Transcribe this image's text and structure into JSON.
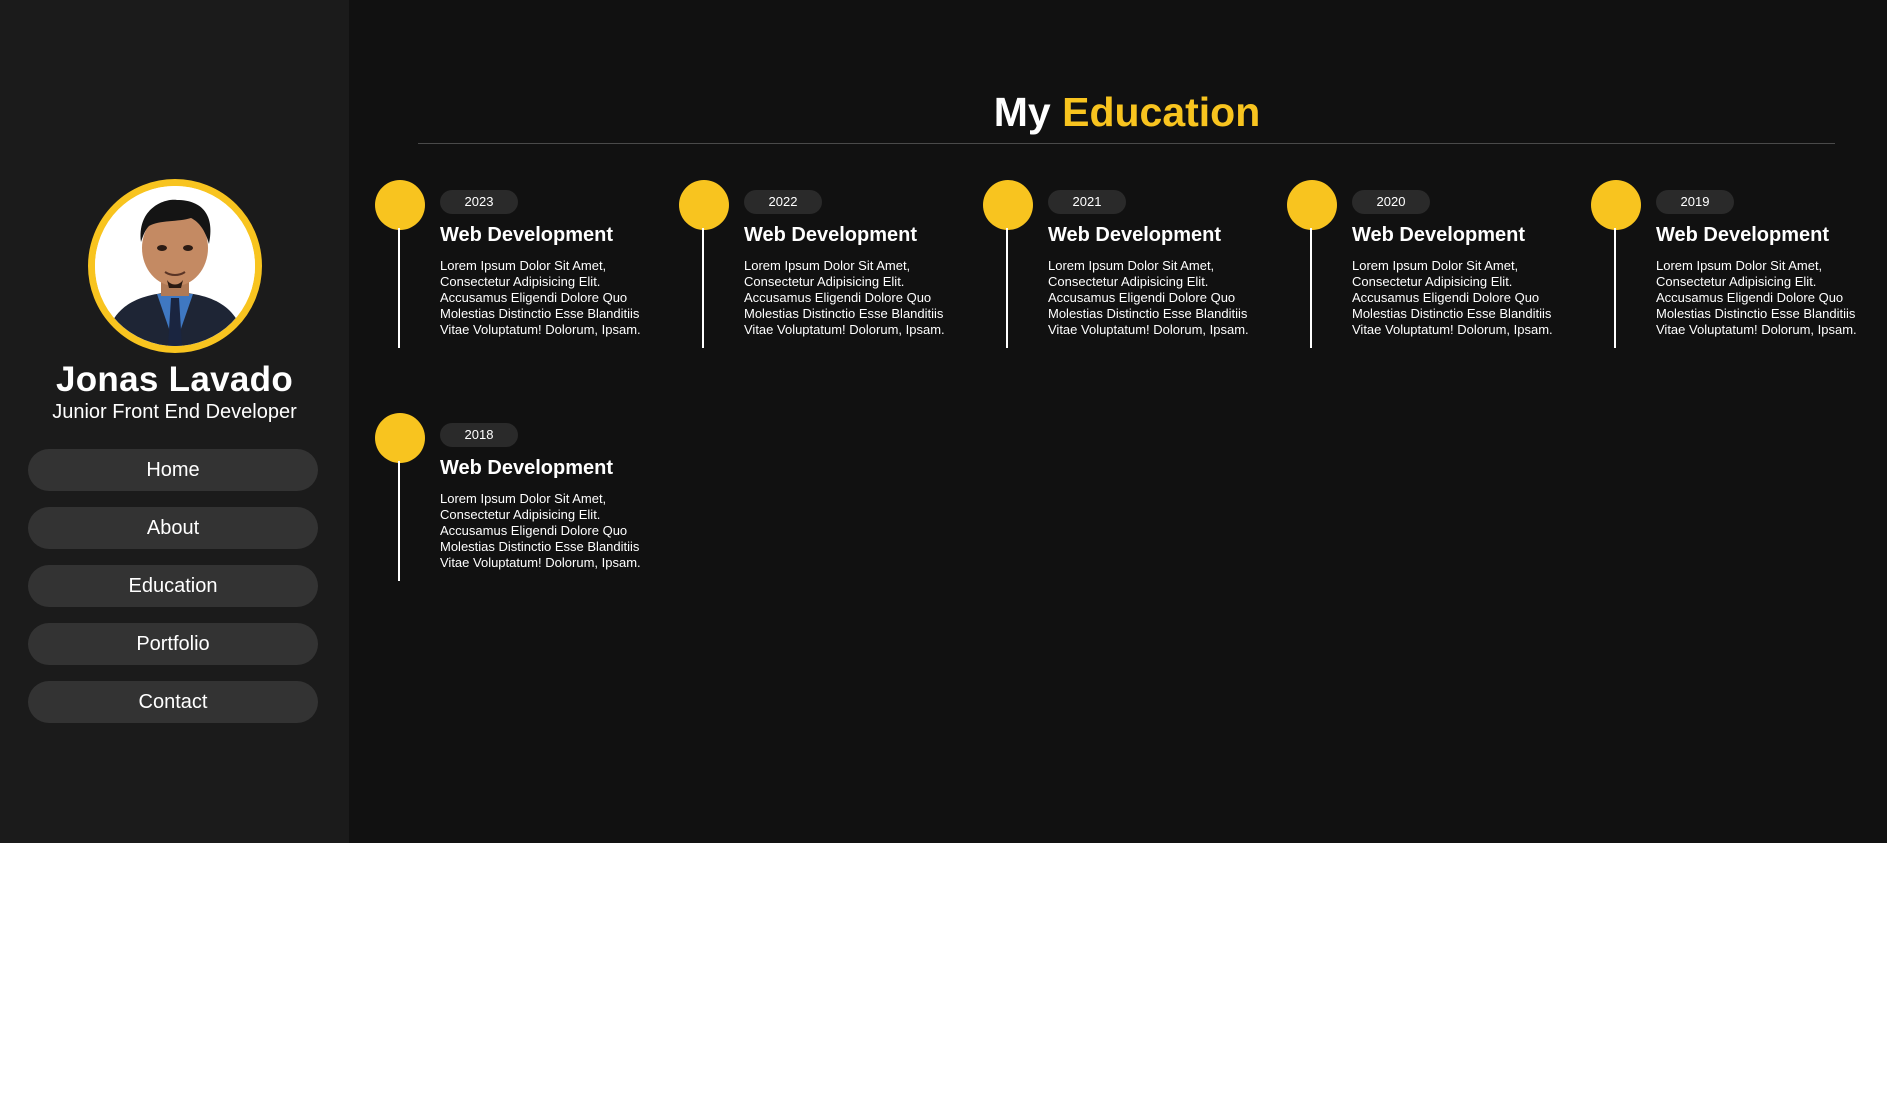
{
  "colors": {
    "accent": "#f8c41f",
    "background": "#111111",
    "sidebar": "#1b1b1b",
    "nav_button": "#333333"
  },
  "profile": {
    "name": "Jonas Lavado",
    "role": "Junior Front End Developer"
  },
  "nav": {
    "items": [
      {
        "label": "Home"
      },
      {
        "label": "About"
      },
      {
        "label": "Education"
      },
      {
        "label": "Portfolio"
      },
      {
        "label": "Contact"
      }
    ]
  },
  "page": {
    "title_plain": "My",
    "title_accent": "Education"
  },
  "education": [
    {
      "year": "2023",
      "title": "Web Development",
      "description": "Lorem Ipsum Dolor Sit Amet, Consectetur Adipisicing Elit. Accusamus Eligendi Dolore Quo Molestias Distinctio Esse Blanditiis Vitae Voluptatum! Dolorum, Ipsam."
    },
    {
      "year": "2022",
      "title": "Web Development",
      "description": "Lorem Ipsum Dolor Sit Amet, Consectetur Adipisicing Elit. Accusamus Eligendi Dolore Quo Molestias Distinctio Esse Blanditiis Vitae Voluptatum! Dolorum, Ipsam."
    },
    {
      "year": "2021",
      "title": "Web Development",
      "description": "Lorem Ipsum Dolor Sit Amet, Consectetur Adipisicing Elit. Accusamus Eligendi Dolore Quo Molestias Distinctio Esse Blanditiis Vitae Voluptatum! Dolorum, Ipsam."
    },
    {
      "year": "2020",
      "title": "Web Development",
      "description": "Lorem Ipsum Dolor Sit Amet, Consectetur Adipisicing Elit. Accusamus Eligendi Dolore Quo Molestias Distinctio Esse Blanditiis Vitae Voluptatum! Dolorum, Ipsam."
    },
    {
      "year": "2019",
      "title": "Web Development",
      "description": "Lorem Ipsum Dolor Sit Amet, Consectetur Adipisicing Elit. Accusamus Eligendi Dolore Quo Molestias Distinctio Esse Blanditiis Vitae Voluptatum! Dolorum, Ipsam."
    },
    {
      "year": "2018",
      "title": "Web Development",
      "description": "Lorem Ipsum Dolor Sit Amet, Consectetur Adipisicing Elit. Accusamus Eligendi Dolore Quo Molestias Distinctio Esse Blanditiis Vitae Voluptatum! Dolorum, Ipsam."
    }
  ]
}
